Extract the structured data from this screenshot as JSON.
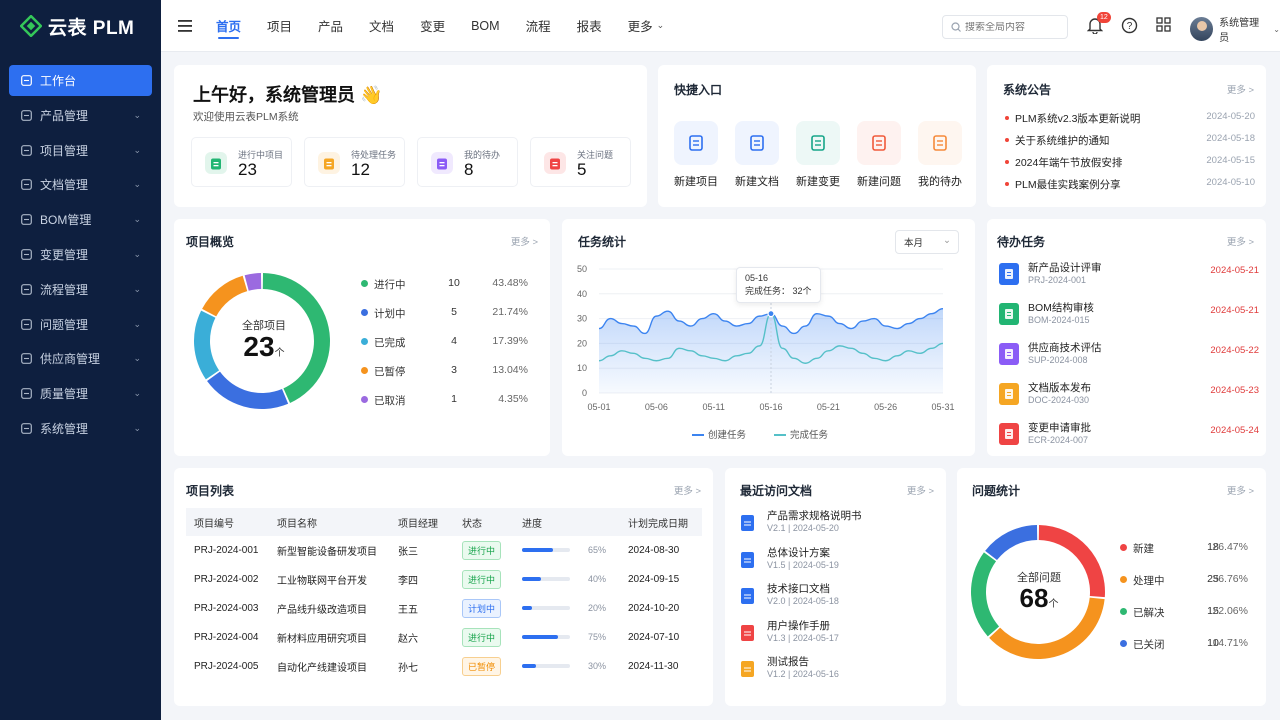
{
  "app": {
    "name": "云表 PLM"
  },
  "sidebar": {
    "items": [
      {
        "label": "工作台"
      },
      {
        "label": "产品管理"
      },
      {
        "label": "项目管理"
      },
      {
        "label": "文档管理"
      },
      {
        "label": "BOM管理"
      },
      {
        "label": "变更管理"
      },
      {
        "label": "流程管理"
      },
      {
        "label": "问题管理"
      },
      {
        "label": "供应商管理"
      },
      {
        "label": "质量管理"
      },
      {
        "label": "系统管理"
      }
    ]
  },
  "topnav": {
    "tabs": [
      "首页",
      "项目",
      "产品",
      "文档",
      "变更",
      "BOM",
      "流程",
      "报表",
      "更多"
    ],
    "search_placeholder": "搜索全局内容",
    "notification_count": "12",
    "user_name": "系统管理员"
  },
  "welcome": {
    "greeting": "上午好，系统管理员 👋",
    "subtitle": "欢迎使用云表PLM系统",
    "stats": [
      {
        "label": "进行中项目",
        "value": "23",
        "color": "#22b573"
      },
      {
        "label": "待处理任务",
        "value": "12",
        "color": "#f5a623"
      },
      {
        "label": "我的待办",
        "value": "8",
        "color": "#8b5cf6"
      },
      {
        "label": "关注问题",
        "value": "5",
        "color": "#ef4444"
      }
    ]
  },
  "quick": {
    "title": "快捷入口",
    "items": [
      {
        "label": "新建项目",
        "color": "#2d6ff0"
      },
      {
        "label": "新建文档",
        "color": "#2d6ff0"
      },
      {
        "label": "新建变更",
        "color": "#17a589"
      },
      {
        "label": "新建问题",
        "color": "#f05a3b"
      },
      {
        "label": "我的待办",
        "color": "#f58a3b"
      }
    ]
  },
  "notices": {
    "title": "系统公告",
    "more": "更多 >",
    "items": [
      {
        "title": "PLM系统v2.3版本更新说明",
        "date": "2024-05-20"
      },
      {
        "title": "关于系统维护的通知",
        "date": "2024-05-18"
      },
      {
        "title": "2024年端午节放假安排",
        "date": "2024-05-15"
      },
      {
        "title": "PLM最佳实践案例分享",
        "date": "2024-05-10"
      }
    ]
  },
  "overview": {
    "title": "项目概览",
    "more": "更多 >",
    "center_label": "全部项目",
    "total": "23",
    "unit": "个",
    "legend": [
      {
        "name": "进行中",
        "count": "10",
        "pct": "43.48%",
        "color": "#2eb872"
      },
      {
        "name": "计划中",
        "count": "5",
        "pct": "21.74%",
        "color": "#3b6fe0"
      },
      {
        "name": "已完成",
        "count": "4",
        "pct": "17.39%",
        "color": "#3aaed8"
      },
      {
        "name": "已暂停",
        "count": "3",
        "pct": "13.04%",
        "color": "#f5931e"
      },
      {
        "name": "已取消",
        "count": "1",
        "pct": "4.35%",
        "color": "#9b6ae0"
      }
    ]
  },
  "task_chart": {
    "title": "任务统计",
    "period": "本月",
    "tooltip_date": "05-16",
    "tooltip_text": "完成任务： 32个"
  },
  "todo": {
    "title": "待办任务",
    "more": "更多 >",
    "items": [
      {
        "name": "新产品设计评审",
        "code": "PRJ-2024-001",
        "date": "2024-05-21",
        "color": "#2d6ff0"
      },
      {
        "name": "BOM结构审核",
        "code": "BOM-2024-015",
        "date": "2024-05-21",
        "color": "#22b573"
      },
      {
        "name": "供应商技术评估",
        "code": "SUP-2024-008",
        "date": "2024-05-22",
        "color": "#8b5cf6"
      },
      {
        "name": "文档版本发布",
        "code": "DOC-2024-030",
        "date": "2024-05-23",
        "color": "#f5a623"
      },
      {
        "name": "变更申请审批",
        "code": "ECR-2024-007",
        "date": "2024-05-24",
        "color": "#ef4444"
      }
    ]
  },
  "project_list": {
    "title": "项目列表",
    "more": "更多 >",
    "columns": [
      "项目编号",
      "项目名称",
      "项目经理",
      "状态",
      "进度",
      "计划完成日期"
    ],
    "rows": [
      {
        "code": "PRJ-2024-001",
        "name": "新型智能设备研发项目",
        "manager": "张三",
        "status": "进行中",
        "kind": "g",
        "progress": 65,
        "progress_text": "65%",
        "date": "2024-08-30"
      },
      {
        "code": "PRJ-2024-002",
        "name": "工业物联网平台开发",
        "manager": "李四",
        "status": "进行中",
        "kind": "g",
        "progress": 40,
        "progress_text": "40%",
        "date": "2024-09-15"
      },
      {
        "code": "PRJ-2024-003",
        "name": "产品线升级改造项目",
        "manager": "王五",
        "status": "计划中",
        "kind": "b",
        "progress": 20,
        "progress_text": "20%",
        "date": "2024-10-20"
      },
      {
        "code": "PRJ-2024-004",
        "name": "新材料应用研究项目",
        "manager": "赵六",
        "status": "进行中",
        "kind": "g",
        "progress": 75,
        "progress_text": "75%",
        "date": "2024-07-10"
      },
      {
        "code": "PRJ-2024-005",
        "name": "自动化产线建设项目",
        "manager": "孙七",
        "status": "已暂停",
        "kind": "o",
        "progress": 30,
        "progress_text": "30%",
        "date": "2024-11-30"
      }
    ]
  },
  "recent_docs": {
    "title": "最近访问文档",
    "more": "更多 >",
    "items": [
      {
        "name": "产品需求规格说明书",
        "meta": "V2.1 | 2024-05-20",
        "color": "#2d6ff0"
      },
      {
        "name": "总体设计方案",
        "meta": "V1.5 | 2024-05-19",
        "color": "#2d6ff0"
      },
      {
        "name": "技术接口文档",
        "meta": "V2.0 | 2024-05-18",
        "color": "#2d6ff0"
      },
      {
        "name": "用户操作手册",
        "meta": "V1.3 | 2024-05-17",
        "color": "#ef4444"
      },
      {
        "name": "测试报告",
        "meta": "V1.2 | 2024-05-16",
        "color": "#f5a623"
      }
    ]
  },
  "issues": {
    "title": "问题统计",
    "more": "更多 >",
    "center_label": "全部问题",
    "total": "68",
    "unit": "个",
    "legend": [
      {
        "name": "新建",
        "count": "18",
        "pct": "26.47%",
        "color": "#ef4444"
      },
      {
        "name": "处理中",
        "count": "25",
        "pct": "36.76%",
        "color": "#f5931e"
      },
      {
        "name": "已解决",
        "count": "15",
        "pct": "22.06%",
        "color": "#2eb872"
      },
      {
        "name": "已关闭",
        "count": "10",
        "pct": "14.71%",
        "color": "#3b6fe0"
      }
    ]
  },
  "chart_data": [
    {
      "type": "pie",
      "title": "全部项目",
      "categories": [
        "进行中",
        "计划中",
        "已完成",
        "已暂停",
        "已取消"
      ],
      "values": [
        10,
        5,
        4,
        3,
        1
      ],
      "colors": [
        "#2eb872",
        "#3b6fe0",
        "#3aaed8",
        "#f5931e",
        "#9b6ae0"
      ]
    },
    {
      "type": "line",
      "title": "任务统计",
      "x": [
        "05-01",
        "05-06",
        "05-11",
        "05-16",
        "05-21",
        "05-26",
        "05-31"
      ],
      "ylim": [
        0,
        50
      ],
      "yticks": [
        0,
        10,
        20,
        30,
        40,
        50
      ],
      "series": [
        {
          "name": "创建任务",
          "color": "#3c84f0",
          "values": [
            26,
            30,
            28,
            27,
            24,
            31,
            33,
            29,
            27,
            30,
            32,
            29,
            27,
            28,
            31,
            32,
            27,
            24,
            27,
            32,
            31,
            28,
            26,
            29,
            30,
            27,
            26,
            28,
            30,
            32,
            34
          ]
        },
        {
          "name": "完成任务",
          "color": "#55c0c8",
          "values": [
            13,
            15,
            17,
            16,
            14,
            13,
            14,
            18,
            17,
            15,
            14,
            13,
            15,
            16,
            19,
            32,
            18,
            14,
            12,
            14,
            17,
            19,
            18,
            16,
            14,
            13,
            15,
            17,
            16,
            18,
            20
          ]
        }
      ]
    },
    {
      "type": "pie",
      "title": "全部问题",
      "categories": [
        "新建",
        "处理中",
        "已解决",
        "已关闭"
      ],
      "values": [
        18,
        25,
        15,
        10
      ],
      "colors": [
        "#ef4444",
        "#f5931e",
        "#2eb872",
        "#3b6fe0"
      ]
    }
  ]
}
